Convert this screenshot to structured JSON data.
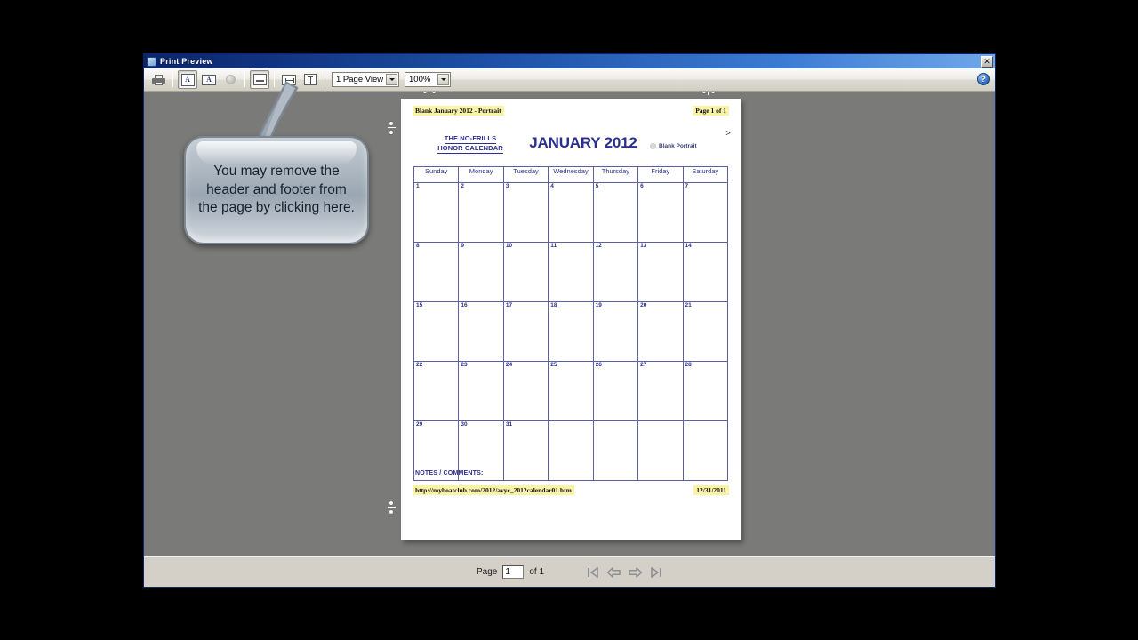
{
  "window": {
    "title": "Print Preview",
    "close_label": "✕",
    "help_label": "?"
  },
  "toolbar": {
    "buttons": [
      {
        "name": "print-button",
        "icon": "printer-icon",
        "tooltip": "Print",
        "pressed": false
      },
      {
        "name": "portrait-button",
        "icon": "page-portrait-icon",
        "glyph": "A",
        "pressed": true
      },
      {
        "name": "landscape-button",
        "icon": "page-landscape-icon",
        "glyph": "A",
        "pressed": false
      },
      {
        "name": "page-setup-button",
        "icon": "circle-icon",
        "pressed": false
      },
      {
        "name": "header-footer-button",
        "icon": "header-footer-icon",
        "pressed": true
      },
      {
        "name": "horizontal-margins-button",
        "icon": "margin-horizontal-icon",
        "pressed": false
      },
      {
        "name": "vertical-margins-button",
        "icon": "margin-vertical-icon",
        "pressed": false
      }
    ],
    "page_view_select": "1 Page View",
    "zoom_select": "100%"
  },
  "page": {
    "header_left": "Blank January 2012 - Portrait",
    "header_right": "Page 1 of 1",
    "brand_line1": "THE NO-FRILLS",
    "brand_line2": "HONOR CALENDAR",
    "month_title": "JANUARY 2012",
    "variant_label": "Blank Portrait",
    "next_arrow": ">",
    "notes_label": "NOTES / COMMENTS:",
    "footer_left": "http://myboatclub.com/2012/avyc_2012calendar01.htm",
    "footer_right": "12/31/2011"
  },
  "calendar": {
    "day_headers": [
      "Sunday",
      "Monday",
      "Tuesday",
      "Wednesday",
      "Thursday",
      "Friday",
      "Saturday"
    ],
    "weeks": [
      [
        "1",
        "2",
        "3",
        "4",
        "5",
        "6",
        "7"
      ],
      [
        "8",
        "9",
        "10",
        "11",
        "12",
        "13",
        "14"
      ],
      [
        "15",
        "16",
        "17",
        "18",
        "19",
        "20",
        "21"
      ],
      [
        "22",
        "23",
        "24",
        "25",
        "26",
        "27",
        "28"
      ],
      [
        "29",
        "30",
        "31",
        "",
        "",
        "",
        ""
      ]
    ]
  },
  "statusbar": {
    "page_label": "Page",
    "page_value": "1",
    "of_label": "of 1",
    "nav": [
      {
        "name": "first-page-button",
        "icon": "first-page-icon",
        "enabled": false
      },
      {
        "name": "previous-page-button",
        "icon": "left-arrow-icon",
        "enabled": false
      },
      {
        "name": "next-page-button",
        "icon": "right-arrow-icon",
        "enabled": false
      },
      {
        "name": "last-page-button",
        "icon": "last-page-icon",
        "enabled": false
      }
    ]
  },
  "callout": {
    "text": "You may remove the header and footer from the page by clicking here."
  },
  "colors": {
    "titlebar_blue": "#0a246a",
    "preview_gray": "#7a7a78",
    "chrome_beige": "#d4d0c8",
    "highlight_yellow": "#f9f3a7",
    "calendar_ink": "#2b2f8f",
    "grid_line": "#5b5fa0"
  }
}
